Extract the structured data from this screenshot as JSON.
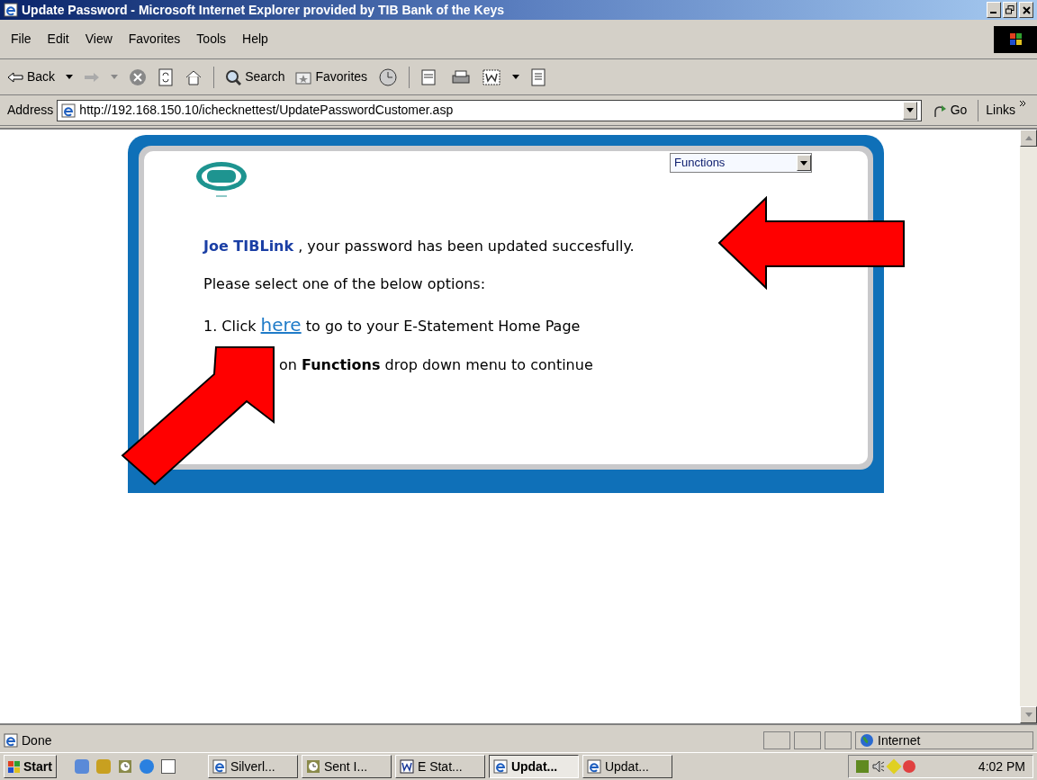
{
  "window": {
    "title": "Update Password - Microsoft Internet Explorer provided by TIB Bank of the Keys"
  },
  "menu": [
    "File",
    "Edit",
    "View",
    "Favorites",
    "Tools",
    "Help"
  ],
  "toolbar": {
    "back": "Back",
    "search": "Search",
    "favorites": "Favorites"
  },
  "address": {
    "label": "Address",
    "url": "http://192.168.150.10/ichecknettest/UpdatePasswordCustomer.asp",
    "go": "Go",
    "links": "Links"
  },
  "page": {
    "functions_select": "Functions",
    "user_name": "Joe TIBLink",
    "message": ", your password has been updated succesfully.",
    "prompt": "Please select one of the below options:",
    "option1": {
      "before": "1. Click",
      "link": "here",
      "after": "to go to your E-Statement Home Page"
    },
    "option2": "on **Functions** drop down menu to continue"
  },
  "status_bar": {
    "text": "Done",
    "zone": "Internet"
  },
  "taskbar": {
    "start": "Start",
    "clock": "4:02 PM",
    "tasks": [
      {
        "label": "Silverl...",
        "kind": "ie",
        "selected": false
      },
      {
        "label": "Sent I...",
        "kind": "clock",
        "selected": false
      },
      {
        "label": "E Stat...",
        "kind": "word",
        "selected": false
      },
      {
        "label": "Updat...",
        "kind": "ie",
        "selected": true
      },
      {
        "label": "Updat...",
        "kind": "ie",
        "selected": false
      }
    ]
  }
}
